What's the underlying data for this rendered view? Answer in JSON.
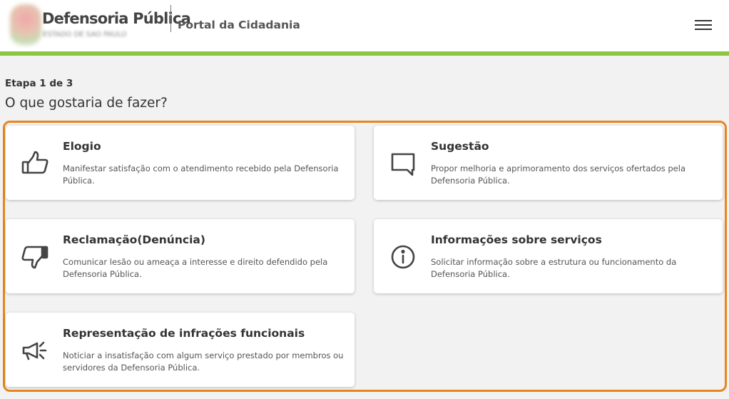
{
  "header": {
    "logo_title": "Defensoria Pública",
    "logo_subtitle": "ESTADO DE SÃO PAULO",
    "portal_title": "Portal da Cidadania",
    "menu_icon": "hamburger-menu-icon"
  },
  "colors": {
    "accent_green": "#8dc63f",
    "highlight_orange": "#e8851f"
  },
  "step": {
    "label": "Etapa 1 de 3",
    "question": "O que gostaria de fazer?"
  },
  "options": [
    {
      "icon": "thumbs-up-icon",
      "title": "Elogio",
      "description": "Manifestar satisfação com o atendimento recebido pela Defensoria Pública."
    },
    {
      "icon": "chat-bubble-icon",
      "title": "Sugestão",
      "description": "Propor melhoria e aprimoramento dos serviços ofertados pela Defensoria Pública."
    },
    {
      "icon": "thumbs-down-icon",
      "title": "Reclamação(Denúncia)",
      "description": "Comunicar lesão ou ameaça a interesse e direito defendido pela Defensoria Pública."
    },
    {
      "icon": "info-icon",
      "title": "Informações sobre serviços",
      "description": "Solicitar informação sobre a estrutura ou funcionamento da Defensoria Pública."
    },
    {
      "icon": "megaphone-icon",
      "title": "Representação de infrações funcionais",
      "description": "Noticiar a insatisfação com algum serviço prestado por membros ou servidores da Defensoria Pública."
    }
  ]
}
